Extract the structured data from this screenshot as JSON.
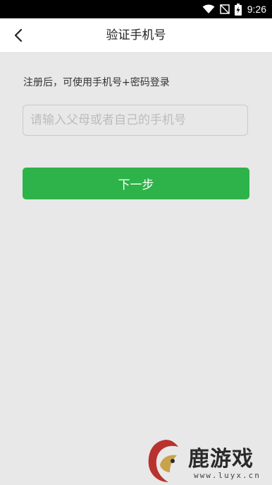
{
  "status_bar": {
    "time": "9:26",
    "icons": [
      "wifi-icon",
      "no-signal-icon",
      "battery-charging-icon"
    ]
  },
  "header": {
    "title": "验证手机号",
    "back_icon": "chevron-left-icon"
  },
  "form": {
    "hint": "注册后，可使用手机号+密码登录",
    "phone_placeholder": "请输入父母或者自己的手机号",
    "phone_value": "",
    "next_label": "下一步"
  },
  "watermark": {
    "brand": "鹿游戏",
    "url": "www.luyx.cn"
  },
  "colors": {
    "accent": "#2db34a",
    "background": "#e8e8e8",
    "header_bg": "#ffffff",
    "logo_red": "#b8332e"
  }
}
